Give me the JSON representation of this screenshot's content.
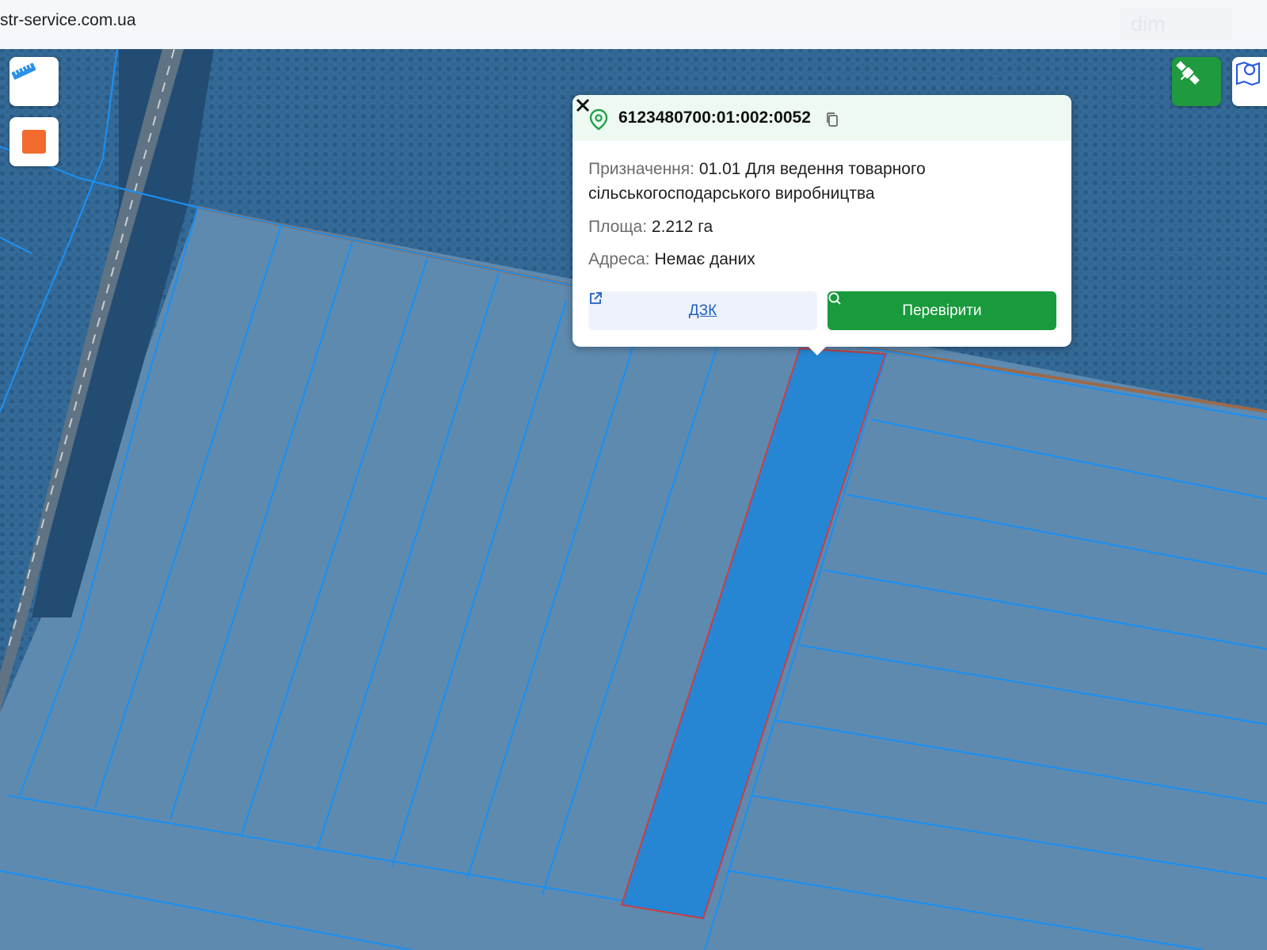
{
  "browser": {
    "url": "str-service.com.ua",
    "watermark": "dim"
  },
  "map": {
    "tools": [
      {
        "name": "ruler-tool",
        "icon": "ruler-icon"
      },
      {
        "name": "draw-tool",
        "icon": "orange-square-icon"
      }
    ],
    "layer_buttons": [
      {
        "name": "satellite-layer-button",
        "icon": "satellite-icon"
      },
      {
        "name": "map-layer-button",
        "icon": "map-pin-icon"
      }
    ],
    "colors": {
      "parcel_line": "#1c8ff0",
      "selected_fill": "#1d86db",
      "selected_border": "#e0302f",
      "accent_green": "#199a3c"
    }
  },
  "popup": {
    "cadastral_number": "6123480700:01:002:0052",
    "purpose_label": "Призначення:",
    "purpose_value_line1": "01.01 Для ведення товарного",
    "purpose_value_line2": "сільськогосподарського виробництва",
    "area_label": "Площа:",
    "area_value": "2.212 га",
    "address_label": "Адреса:",
    "address_value": "Немає даних",
    "dzk_button": "ДЗК",
    "check_button": "Перевірити"
  }
}
